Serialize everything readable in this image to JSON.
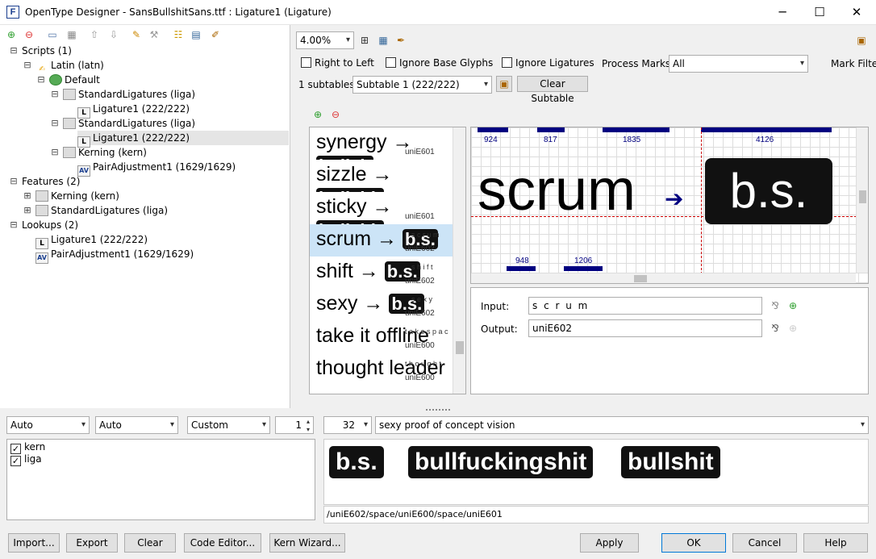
{
  "window": {
    "title": "OpenType Designer - SansBullshitSans.ttf : Ligature1 (Ligature)",
    "app_icon_letter": "F",
    "minimize": "─",
    "maximize": "☐",
    "close": "✕"
  },
  "tree": {
    "nodes": [
      {
        "label": "Scripts (1)",
        "exp": "⊟"
      },
      {
        "label": "Latin (latn)",
        "exp": "⊟"
      },
      {
        "label": "Default",
        "exp": "⊟"
      },
      {
        "label": "StandardLigatures (liga)",
        "exp": "⊟"
      },
      {
        "label": "Ligature1 (222/222)",
        "icon": "L"
      },
      {
        "label": "StandardLigatures (liga)",
        "exp": "⊟"
      },
      {
        "label": "Ligature1 (222/222)",
        "icon": "L"
      },
      {
        "label": "Kerning (kern)",
        "exp": "⊟"
      },
      {
        "label": "PairAdjustment1 (1629/1629)",
        "icon": "AV"
      },
      {
        "label": "Features (2)",
        "exp": "⊟"
      },
      {
        "label": "Kerning (kern)",
        "exp": "⊞"
      },
      {
        "label": "StandardLigatures (liga)",
        "exp": "⊞"
      },
      {
        "label": "Lookups (2)",
        "exp": "⊟"
      },
      {
        "label": "Ligature1 (222/222)",
        "icon": "L"
      },
      {
        "label": "PairAdjustment1 (1629/1629)",
        "icon": "AV"
      }
    ]
  },
  "editor": {
    "zoom": "4.00%",
    "right_to_left": "Right to Left",
    "ignore_base_glyphs": "Ignore Base Glyphs",
    "ignore_ligatures": "Ignore Ligatures",
    "process_marks_label": "Process Marks:",
    "process_marks_value": "All",
    "mark_filter": "Mark Filte",
    "subtables_count": "1 subtables",
    "subtable_value": "Subtable 1 (222/222)",
    "clear_subtable": "Clear Subtable"
  },
  "glyph_list": [
    {
      "word": "synergy",
      "lig": "builsh",
      "sub": "uniE601"
    },
    {
      "word": "sizzle",
      "lig": "bullshit",
      "sub": ""
    },
    {
      "word": "sticky",
      "lig": "bullshit",
      "sub": "uniE601"
    },
    {
      "word": "scrum",
      "lig": "b.s.",
      "sub": "uniE602",
      "over": "s c r u m"
    },
    {
      "word": "shift",
      "lig": "b.s.",
      "sub": "uniE602",
      "over": "s h i f t"
    },
    {
      "word": "sexy",
      "lig": "b.s.",
      "sub": "uniE602",
      "over": "s e x y"
    },
    {
      "word": "take it offline",
      "lig": "",
      "sub": "uniE600",
      "over": "t a k e  s p a c"
    },
    {
      "word": "thought leader",
      "lig": "",
      "sub": "uniE600",
      "over": "t h o u g h t"
    }
  ],
  "canvas": {
    "word": "scrum",
    "lig": "b.s.",
    "widths_top": [
      "924",
      "817",
      "1835",
      "4126"
    ],
    "widths_bottom": [
      "948",
      "1206"
    ]
  },
  "io": {
    "input_label": "Input:",
    "input_value": "s c r u m",
    "output_label": "Output:",
    "output_value": "uniE602"
  },
  "bottom": {
    "script_combo": "Auto",
    "lang_combo": "Auto",
    "dir_combo": "Custom",
    "spin_value": "1",
    "size_value": "32",
    "sample_text": "sexy proof of concept vision",
    "features": [
      {
        "label": "kern"
      },
      {
        "label": "liga"
      }
    ],
    "preview_glyphs": [
      "b.s.",
      "bullfuckingshit",
      "bullshit"
    ],
    "glyph_path": "/uniE602/space/uniE600/space/uniE601"
  },
  "buttons": {
    "import": "Import...",
    "export": "Export",
    "clear": "Clear",
    "code_editor": "Code Editor...",
    "kern_wizard": "Kern Wizard...",
    "apply": "Apply",
    "ok": "OK",
    "cancel": "Cancel",
    "help": "Help"
  }
}
